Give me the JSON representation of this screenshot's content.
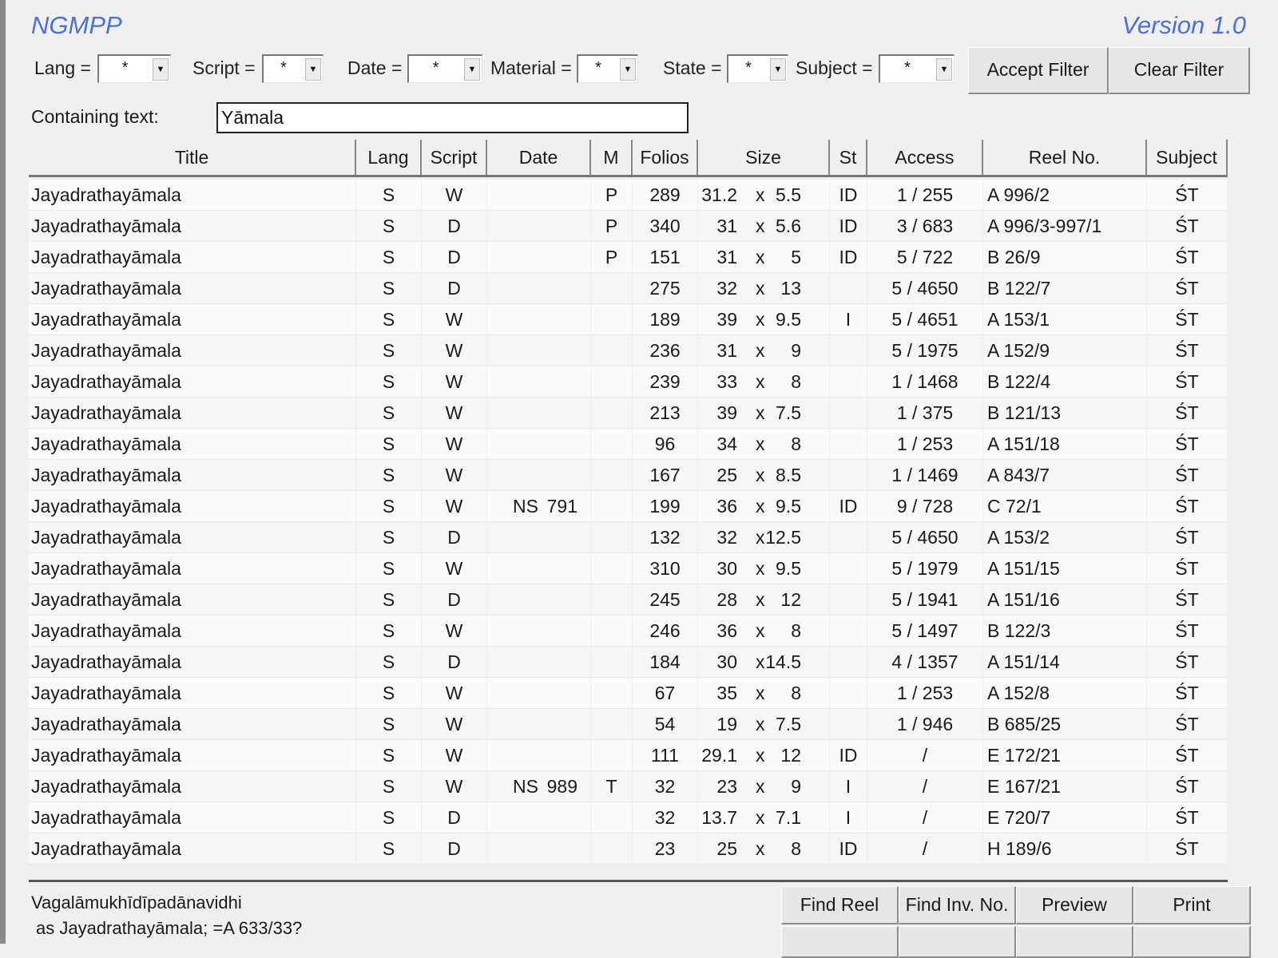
{
  "app": {
    "title": "NGMPP",
    "version": "Version 1.0"
  },
  "filters": {
    "lang_label": "Lang =",
    "lang_value": "*",
    "script_label": "Script =",
    "script_value": "*",
    "date_label": "Date =",
    "date_value": "*",
    "material_label": "Material =",
    "material_value": "*",
    "state_label": "State =",
    "state_value": "*",
    "subject_label": "Subject =",
    "subject_value": "*",
    "accept_label": "Accept Filter",
    "clear_label": "Clear Filter"
  },
  "search": {
    "label": "Containing text:",
    "value": "Yāmala"
  },
  "table": {
    "columns": [
      "Title",
      "Lang",
      "Script",
      "Date",
      "M",
      "Folios",
      "Size",
      "St",
      "Access",
      "Reel No.",
      "Subject"
    ],
    "size_separator": "x",
    "rows": [
      {
        "title": "Jayadrathayāmala",
        "lang": "S",
        "script": "W",
        "era": "",
        "year": "",
        "m": "P",
        "folios": "289",
        "w": "31.2",
        "h": "5.5",
        "st": "ID",
        "access": "1 / 255",
        "reel": "A 996/2",
        "subject": "ŚT"
      },
      {
        "title": "Jayadrathayāmala",
        "lang": "S",
        "script": "D",
        "era": "",
        "year": "",
        "m": "P",
        "folios": "340",
        "w": "31",
        "h": "5.6",
        "st": "ID",
        "access": "3 / 683",
        "reel": "A 996/3-997/1",
        "subject": "ŚT"
      },
      {
        "title": "Jayadrathayāmala",
        "lang": "S",
        "script": "D",
        "era": "",
        "year": "",
        "m": "P",
        "folios": "151",
        "w": "31",
        "h": "5",
        "st": "ID",
        "access": "5 / 722",
        "reel": "B 26/9",
        "subject": "ŚT"
      },
      {
        "title": "Jayadrathayāmala",
        "lang": "S",
        "script": "D",
        "era": "",
        "year": "",
        "m": "",
        "folios": "275",
        "w": "32",
        "h": "13",
        "st": "",
        "access": "5 / 4650",
        "reel": "B 122/7",
        "subject": "ŚT"
      },
      {
        "title": "Jayadrathayāmala",
        "lang": "S",
        "script": "W",
        "era": "",
        "year": "",
        "m": "",
        "folios": "189",
        "w": "39",
        "h": "9.5",
        "st": "I",
        "access": "5 / 4651",
        "reel": "A 153/1",
        "subject": "ŚT"
      },
      {
        "title": "Jayadrathayāmala",
        "lang": "S",
        "script": "W",
        "era": "",
        "year": "",
        "m": "",
        "folios": "236",
        "w": "31",
        "h": "9",
        "st": "",
        "access": "5 / 1975",
        "reel": "A 152/9",
        "subject": "ŚT"
      },
      {
        "title": "Jayadrathayāmala",
        "lang": "S",
        "script": "W",
        "era": "",
        "year": "",
        "m": "",
        "folios": "239",
        "w": "33",
        "h": "8",
        "st": "",
        "access": "1 / 1468",
        "reel": "B 122/4",
        "subject": "ŚT"
      },
      {
        "title": "Jayadrathayāmala",
        "lang": "S",
        "script": "W",
        "era": "",
        "year": "",
        "m": "",
        "folios": "213",
        "w": "39",
        "h": "7.5",
        "st": "",
        "access": "1 / 375",
        "reel": "B 121/13",
        "subject": "ŚT"
      },
      {
        "title": "Jayadrathayāmala",
        "lang": "S",
        "script": "W",
        "era": "",
        "year": "",
        "m": "",
        "folios": "96",
        "w": "34",
        "h": "8",
        "st": "",
        "access": "1 / 253",
        "reel": "A 151/18",
        "subject": "ŚT"
      },
      {
        "title": "Jayadrathayāmala",
        "lang": "S",
        "script": "W",
        "era": "",
        "year": "",
        "m": "",
        "folios": "167",
        "w": "25",
        "h": "8.5",
        "st": "",
        "access": "1 / 1469",
        "reel": "A 843/7",
        "subject": "ŚT"
      },
      {
        "title": "Jayadrathayāmala",
        "lang": "S",
        "script": "W",
        "era": "NS",
        "year": "791",
        "m": "",
        "folios": "199",
        "w": "36",
        "h": "9.5",
        "st": "ID",
        "access": "9 / 728",
        "reel": "C 72/1",
        "subject": "ŚT"
      },
      {
        "title": "Jayadrathayāmala",
        "lang": "S",
        "script": "D",
        "era": "",
        "year": "",
        "m": "",
        "folios": "132",
        "w": "32",
        "h": "12.5",
        "st": "",
        "access": "5 / 4650",
        "reel": "A 153/2",
        "subject": "ŚT"
      },
      {
        "title": "Jayadrathayāmala",
        "lang": "S",
        "script": "W",
        "era": "",
        "year": "",
        "m": "",
        "folios": "310",
        "w": "30",
        "h": "9.5",
        "st": "",
        "access": "5 / 1979",
        "reel": "A 151/15",
        "subject": "ŚT"
      },
      {
        "title": "Jayadrathayāmala",
        "lang": "S",
        "script": "D",
        "era": "",
        "year": "",
        "m": "",
        "folios": "245",
        "w": "28",
        "h": "12",
        "st": "",
        "access": "5 / 1941",
        "reel": "A 151/16",
        "subject": "ŚT"
      },
      {
        "title": "Jayadrathayāmala",
        "lang": "S",
        "script": "W",
        "era": "",
        "year": "",
        "m": "",
        "folios": "246",
        "w": "36",
        "h": "8",
        "st": "",
        "access": "5 / 1497",
        "reel": "B 122/3",
        "subject": "ŚT"
      },
      {
        "title": "Jayadrathayāmala",
        "lang": "S",
        "script": "D",
        "era": "",
        "year": "",
        "m": "",
        "folios": "184",
        "w": "30",
        "h": "14.5",
        "st": "",
        "access": "4 / 1357",
        "reel": "A 151/14",
        "subject": "ŚT"
      },
      {
        "title": "Jayadrathayāmala",
        "lang": "S",
        "script": "W",
        "era": "",
        "year": "",
        "m": "",
        "folios": "67",
        "w": "35",
        "h": "8",
        "st": "",
        "access": "1 / 253",
        "reel": "A 152/8",
        "subject": "ŚT"
      },
      {
        "title": "Jayadrathayāmala",
        "lang": "S",
        "script": "W",
        "era": "",
        "year": "",
        "m": "",
        "folios": "54",
        "w": "19",
        "h": "7.5",
        "st": "",
        "access": "1 / 946",
        "reel": "B 685/25",
        "subject": "ŚT"
      },
      {
        "title": "Jayadrathayāmala",
        "lang": "S",
        "script": "W",
        "era": "",
        "year": "",
        "m": "",
        "folios": "111",
        "w": "29.1",
        "h": "12",
        "st": "ID",
        "access": "/",
        "reel": "E 172/21",
        "subject": "ŚT"
      },
      {
        "title": "Jayadrathayāmala",
        "lang": "S",
        "script": "W",
        "era": "NS",
        "year": "989",
        "m": "T",
        "folios": "32",
        "w": "23",
        "h": "9",
        "st": "I",
        "access": "/",
        "reel": "E 167/21",
        "subject": "ŚT"
      },
      {
        "title": "Jayadrathayāmala",
        "lang": "S",
        "script": "D",
        "era": "",
        "year": "",
        "m": "",
        "folios": "32",
        "w": "13.7",
        "h": "7.1",
        "st": "I",
        "access": "/",
        "reel": "E 720/7",
        "subject": "ŚT"
      },
      {
        "title": "Jayadrathayāmala",
        "lang": "S",
        "script": "D",
        "era": "",
        "year": "",
        "m": "",
        "folios": "23",
        "w": "25",
        "h": "8",
        "st": "ID",
        "access": "/",
        "reel": "H 189/6",
        "subject": "ŚT"
      }
    ]
  },
  "detail": {
    "line1": "Vagalāmukhīdīpadānavidhi",
    "line2": "as Jayadrathayāmala; =A 633/33?"
  },
  "actions": {
    "find_reel": "Find Reel",
    "find_inv": "Find Inv. No.",
    "preview": "Preview",
    "print": "Print"
  }
}
